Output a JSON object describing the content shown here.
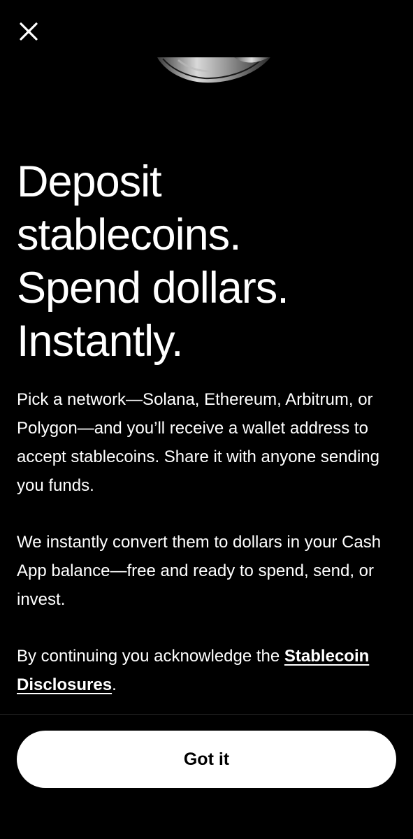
{
  "header": {
    "close_icon": "close-icon"
  },
  "hero": {
    "image_icon": "coin-illustration"
  },
  "headline": {
    "line1": "Deposit",
    "line2": "stablecoins.",
    "line3": "Spend dollars.",
    "line4": "Instantly."
  },
  "body": {
    "paragraph1": "Pick a network—Solana, Ethereum, Arbitrum, or Polygon—and you’ll receive a wallet address to accept stablecoins. Share it with anyone sending you funds.",
    "paragraph2": "We instantly convert them to dollars in your Cash App balance—free and ready to spend, send, or invest.",
    "disclaimer_prefix": "By continuing you acknowledge the ",
    "disclaimer_link": "Stablecoin Disclosures",
    "disclaimer_suffix": "."
  },
  "footer": {
    "button_label": "Got it"
  },
  "colors": {
    "background": "#000000",
    "text": "#ffffff",
    "button_bg": "#ffffff",
    "button_text": "#000000"
  }
}
